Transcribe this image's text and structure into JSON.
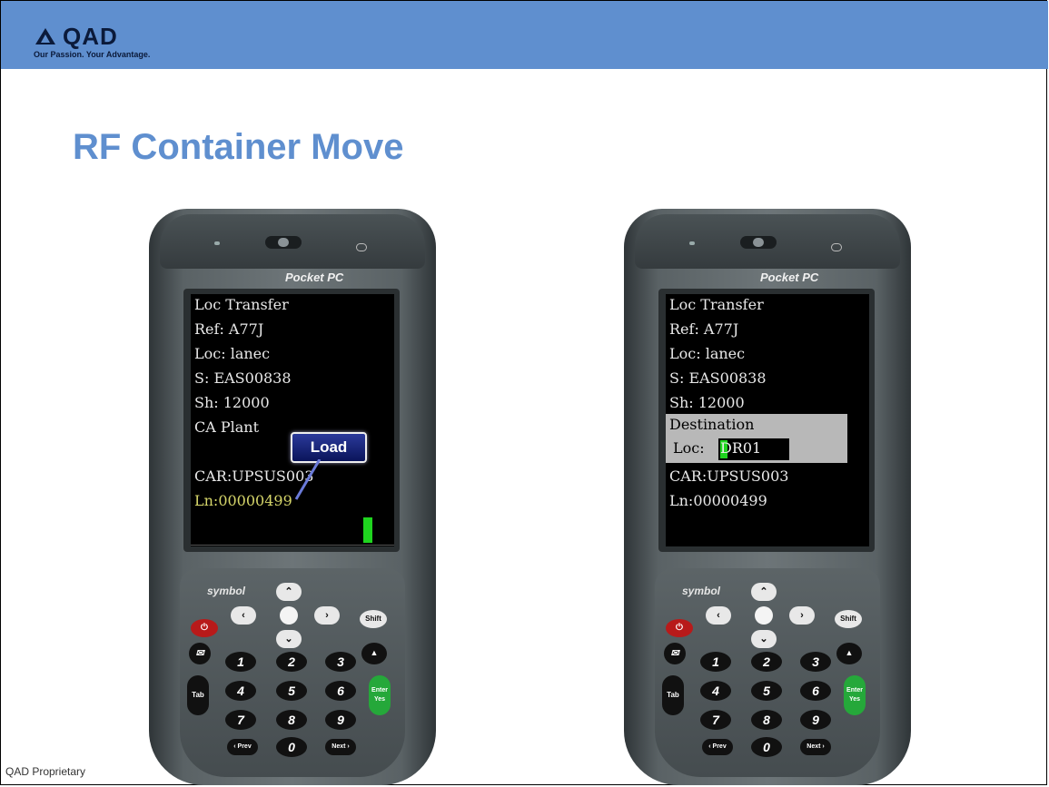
{
  "header": {
    "logo_text": "QAD",
    "tagline": "Our Passion. Your Advantage.",
    "accent_color": "#5f8fcf"
  },
  "title": "RF Container Move",
  "footer": "QAD Proprietary",
  "devices": [
    {
      "brand": "Pocket PC",
      "keypad_brand": "symbol",
      "screen_lines": [
        "Loc Transfer",
        "Ref: A77J",
        "Loc: lanec",
        "S: EAS00838",
        "Sh: 12000",
        "CA Plant",
        "CAR:UPSUS003",
        "Ln:00000499"
      ],
      "callout": "Load"
    },
    {
      "brand": "Pocket PC",
      "keypad_brand": "symbol",
      "screen_lines": [
        "Loc Transfer",
        "Ref: A77J",
        "Loc: lanec",
        "S: EAS00838",
        "Sh: 12000",
        "CAR:UPSUS003",
        "Ln:00000499"
      ],
      "destination_label": "Destination",
      "destination_loc_label": "Loc:",
      "destination_loc_value": "DR01"
    }
  ],
  "keys": {
    "power": "⏻",
    "left": "‹",
    "right": "›",
    "shift": "Shift",
    "tab": "Tab",
    "enter": "Enter Yes",
    "mail": "✉",
    "prev": "‹ Prev",
    "next": "Next ›",
    "digits": [
      "1",
      "2",
      "3",
      "4",
      "5",
      "6",
      "7",
      "8",
      "9",
      "0"
    ]
  }
}
